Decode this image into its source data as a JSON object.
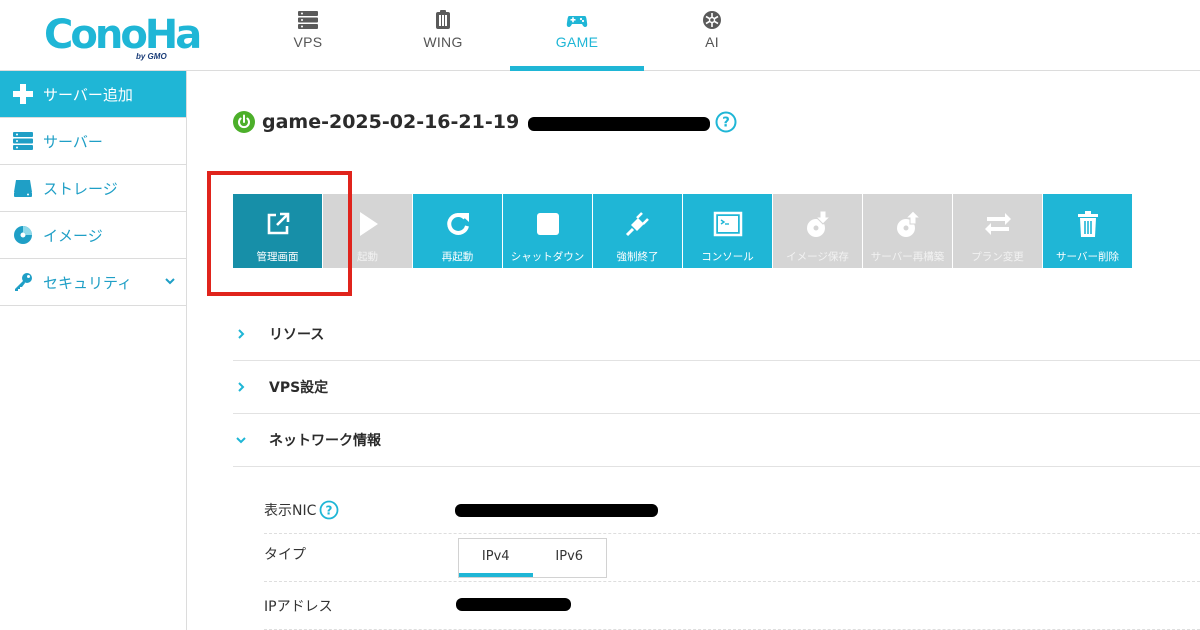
{
  "header": {
    "logo": {
      "main": "ConoHa",
      "sub": "by GMO"
    },
    "tabs": [
      {
        "label": "VPS",
        "icon": "server-stack-icon",
        "active": false
      },
      {
        "label": "WING",
        "icon": "wing-icon",
        "active": false
      },
      {
        "label": "GAME",
        "icon": "gamepad-icon",
        "active": true
      },
      {
        "label": "AI",
        "icon": "ai-chip-icon",
        "active": false
      }
    ]
  },
  "sidebar": {
    "items": [
      {
        "label": "サーバー追加",
        "icon": "plus-icon"
      },
      {
        "label": "サーバー",
        "icon": "server-icon"
      },
      {
        "label": "ストレージ",
        "icon": "storage-icon"
      },
      {
        "label": "イメージ",
        "icon": "image-disc-icon"
      },
      {
        "label": "セキュリティ",
        "icon": "key-icon"
      }
    ]
  },
  "server": {
    "name": "game-2025-02-16-21-19",
    "status": "running"
  },
  "toolbar": {
    "buttons": [
      {
        "label": "管理画面",
        "icon": "external-link-icon",
        "enabled": true
      },
      {
        "label": "起動",
        "icon": "play-icon",
        "enabled": false
      },
      {
        "label": "再起動",
        "icon": "restart-icon",
        "enabled": true
      },
      {
        "label": "シャットダウン",
        "icon": "stop-icon",
        "enabled": true
      },
      {
        "label": "強制終了",
        "icon": "plug-icon",
        "enabled": true
      },
      {
        "label": "コンソール",
        "icon": "console-icon",
        "enabled": true
      },
      {
        "label": "イメージ保存",
        "icon": "image-save-icon",
        "enabled": false
      },
      {
        "label": "サーバー再構築",
        "icon": "rebuild-icon",
        "enabled": false
      },
      {
        "label": "プラン変更",
        "icon": "swap-icon",
        "enabled": false
      },
      {
        "label": "サーバー削除",
        "icon": "trash-icon",
        "enabled": true
      }
    ]
  },
  "sections": [
    {
      "label": "リソース",
      "expanded": false
    },
    {
      "label": "VPS設定",
      "expanded": false
    },
    {
      "label": "ネットワーク情報",
      "expanded": true
    }
  ],
  "network": {
    "nic_label": "表示NIC",
    "type_label": "タイプ",
    "type_options": [
      "IPv4",
      "IPv6"
    ],
    "type_selected": "IPv4",
    "ip_label": "IPアドレス"
  },
  "colors": {
    "accent": "#1fb6d6",
    "accent_dark": "#178fa8",
    "disabled": "#d5d5d5",
    "highlight": "#e0241c",
    "status_on": "#4caf2a"
  }
}
